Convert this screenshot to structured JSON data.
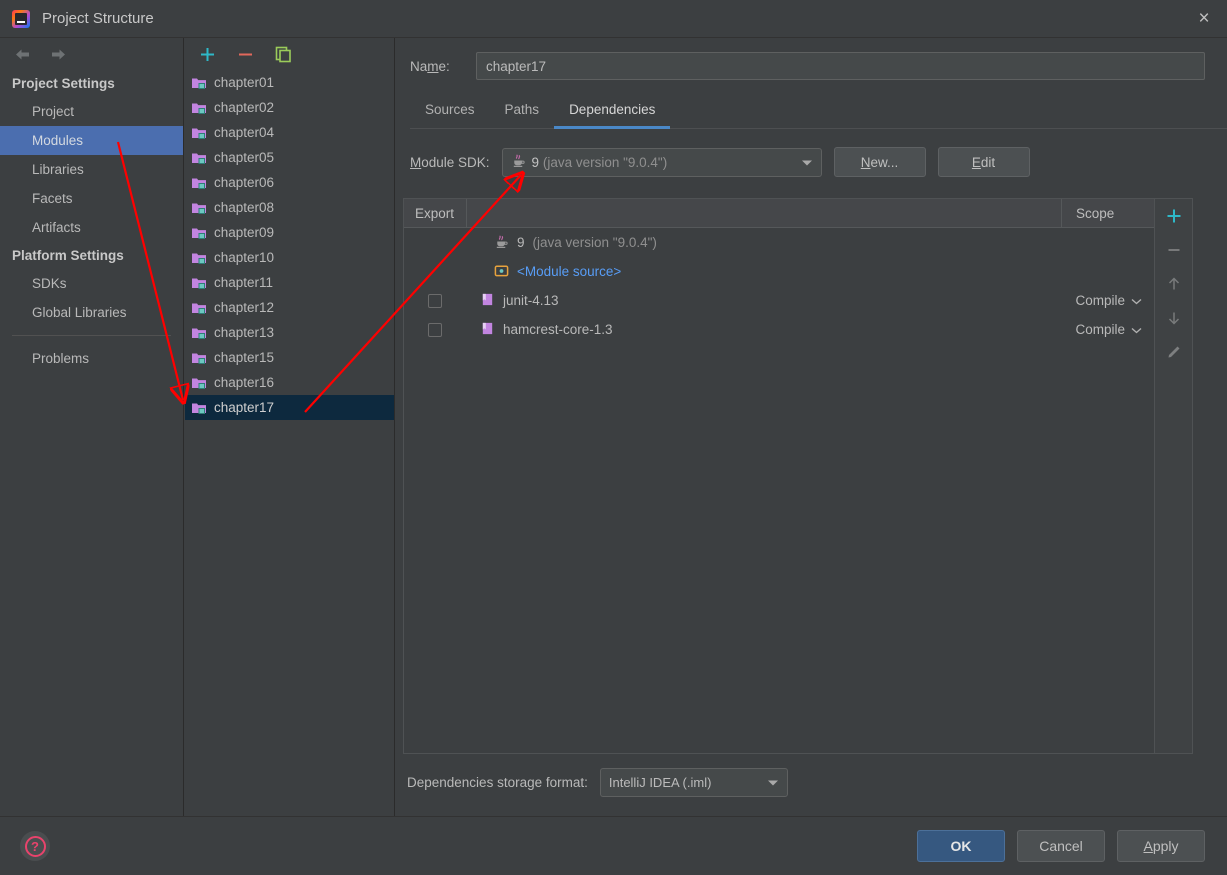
{
  "window": {
    "title": "Project Structure",
    "app_icon": "intellij-idea-icon",
    "close_label": "×"
  },
  "sidebar": {
    "back_icon": "back-arrow-icon",
    "forward_icon": "forward-arrow-icon",
    "groups": [
      {
        "title": "Project Settings",
        "items": [
          {
            "label": "Project",
            "selected": false
          },
          {
            "label": "Modules",
            "selected": true
          },
          {
            "label": "Libraries",
            "selected": false
          },
          {
            "label": "Facets",
            "selected": false
          },
          {
            "label": "Artifacts",
            "selected": false
          }
        ]
      },
      {
        "title": "Platform Settings",
        "items": [
          {
            "label": "SDKs",
            "selected": false
          },
          {
            "label": "Global Libraries",
            "selected": false
          }
        ]
      }
    ],
    "problems_label": "Problems"
  },
  "modules_panel": {
    "toolbar": {
      "add_icon": "plus-icon",
      "remove_icon": "minus-icon",
      "copy_icon": "copy-icon",
      "add_color": "#2eb8c8",
      "remove_color": "#e2685c",
      "copy_color": "#9bcc5a"
    },
    "items": [
      {
        "label": "chapter01",
        "selected": false
      },
      {
        "label": "chapter02",
        "selected": false
      },
      {
        "label": "chapter04",
        "selected": false
      },
      {
        "label": "chapter05",
        "selected": false
      },
      {
        "label": "chapter06",
        "selected": false
      },
      {
        "label": "chapter08",
        "selected": false
      },
      {
        "label": "chapter09",
        "selected": false
      },
      {
        "label": "chapter10",
        "selected": false
      },
      {
        "label": "chapter11",
        "selected": false
      },
      {
        "label": "chapter12",
        "selected": false
      },
      {
        "label": "chapter13",
        "selected": false
      },
      {
        "label": "chapter15",
        "selected": false
      },
      {
        "label": "chapter16",
        "selected": false
      },
      {
        "label": "chapter17",
        "selected": true
      }
    ]
  },
  "main": {
    "name_label": "Name:",
    "name_value": "chapter17",
    "tabs": [
      {
        "label": "Sources",
        "active": false
      },
      {
        "label": "Paths",
        "active": false
      },
      {
        "label": "Dependencies",
        "active": true
      }
    ],
    "sdk": {
      "label": "Module SDK:",
      "value_version": "9",
      "value_detail": "(java version \"9.0.4\")",
      "new_button": "New...",
      "edit_button": "Edit"
    },
    "table": {
      "columns": {
        "export": "Export",
        "scope": "Scope"
      },
      "rows": [
        {
          "icon": "java-sdk-icon",
          "name": "9",
          "name_detail": "(java version \"9.0.4\")",
          "has_checkbox": false,
          "scope": "",
          "link": false
        },
        {
          "icon": "module-source-folder-icon",
          "name": "<Module source>",
          "name_detail": "",
          "has_checkbox": false,
          "scope": "",
          "link": true
        },
        {
          "icon": "library-icon",
          "name": "junit-4.13",
          "name_detail": "",
          "has_checkbox": true,
          "checked": false,
          "scope": "Compile",
          "link": false
        },
        {
          "icon": "library-icon",
          "name": "hamcrest-core-1.3",
          "name_detail": "",
          "has_checkbox": true,
          "checked": false,
          "scope": "Compile",
          "link": false
        }
      ],
      "side_toolbar": [
        {
          "icon": "plus-icon",
          "name": "add-dependency-button"
        },
        {
          "icon": "minus-icon",
          "name": "remove-dependency-button"
        },
        {
          "icon": "arrow-up-icon",
          "name": "move-up-button"
        },
        {
          "icon": "arrow-down-icon",
          "name": "move-down-button"
        },
        {
          "icon": "pencil-icon",
          "name": "edit-dependency-button"
        }
      ]
    },
    "storage": {
      "label": "Dependencies storage format:",
      "value": "IntelliJ IDEA (.iml)"
    }
  },
  "bottom": {
    "help_icon": "help-question-icon",
    "buttons": [
      {
        "label": "OK",
        "primary": true
      },
      {
        "label": "Cancel",
        "primary": false
      },
      {
        "label": "Apply",
        "primary": false
      }
    ]
  },
  "annotations": {
    "color": "#ff0000",
    "arrow_1": "modules-to-chapter17-arrow",
    "arrow_2": "chapter17-to-module-sdk-arrow"
  },
  "colors": {
    "window_bg": "#3c3f41",
    "selection_blue": "#4b6eaf",
    "selection_inactive": "#0d293e",
    "tab_underline": "#4a88c7",
    "link_blue": "#589df6",
    "primary_button": "#365880",
    "annotation_red": "#ff0000"
  }
}
